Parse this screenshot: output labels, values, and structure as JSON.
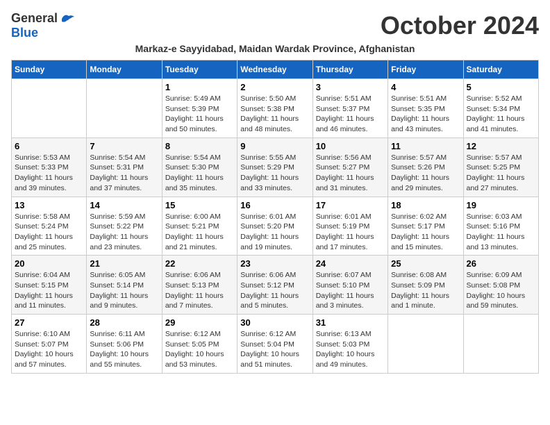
{
  "logo": {
    "general": "General",
    "blue": "Blue"
  },
  "title": "October 2024",
  "subtitle": "Markaz-e Sayyidabad, Maidan Wardak Province, Afghanistan",
  "weekdays": [
    "Sunday",
    "Monday",
    "Tuesday",
    "Wednesday",
    "Thursday",
    "Friday",
    "Saturday"
  ],
  "weeks": [
    [
      {
        "day": "",
        "sunrise": "",
        "sunset": "",
        "daylight": ""
      },
      {
        "day": "",
        "sunrise": "",
        "sunset": "",
        "daylight": ""
      },
      {
        "day": "1",
        "sunrise": "Sunrise: 5:49 AM",
        "sunset": "Sunset: 5:39 PM",
        "daylight": "Daylight: 11 hours and 50 minutes."
      },
      {
        "day": "2",
        "sunrise": "Sunrise: 5:50 AM",
        "sunset": "Sunset: 5:38 PM",
        "daylight": "Daylight: 11 hours and 48 minutes."
      },
      {
        "day": "3",
        "sunrise": "Sunrise: 5:51 AM",
        "sunset": "Sunset: 5:37 PM",
        "daylight": "Daylight: 11 hours and 46 minutes."
      },
      {
        "day": "4",
        "sunrise": "Sunrise: 5:51 AM",
        "sunset": "Sunset: 5:35 PM",
        "daylight": "Daylight: 11 hours and 43 minutes."
      },
      {
        "day": "5",
        "sunrise": "Sunrise: 5:52 AM",
        "sunset": "Sunset: 5:34 PM",
        "daylight": "Daylight: 11 hours and 41 minutes."
      }
    ],
    [
      {
        "day": "6",
        "sunrise": "Sunrise: 5:53 AM",
        "sunset": "Sunset: 5:33 PM",
        "daylight": "Daylight: 11 hours and 39 minutes."
      },
      {
        "day": "7",
        "sunrise": "Sunrise: 5:54 AM",
        "sunset": "Sunset: 5:31 PM",
        "daylight": "Daylight: 11 hours and 37 minutes."
      },
      {
        "day": "8",
        "sunrise": "Sunrise: 5:54 AM",
        "sunset": "Sunset: 5:30 PM",
        "daylight": "Daylight: 11 hours and 35 minutes."
      },
      {
        "day": "9",
        "sunrise": "Sunrise: 5:55 AM",
        "sunset": "Sunset: 5:29 PM",
        "daylight": "Daylight: 11 hours and 33 minutes."
      },
      {
        "day": "10",
        "sunrise": "Sunrise: 5:56 AM",
        "sunset": "Sunset: 5:27 PM",
        "daylight": "Daylight: 11 hours and 31 minutes."
      },
      {
        "day": "11",
        "sunrise": "Sunrise: 5:57 AM",
        "sunset": "Sunset: 5:26 PM",
        "daylight": "Daylight: 11 hours and 29 minutes."
      },
      {
        "day": "12",
        "sunrise": "Sunrise: 5:57 AM",
        "sunset": "Sunset: 5:25 PM",
        "daylight": "Daylight: 11 hours and 27 minutes."
      }
    ],
    [
      {
        "day": "13",
        "sunrise": "Sunrise: 5:58 AM",
        "sunset": "Sunset: 5:24 PM",
        "daylight": "Daylight: 11 hours and 25 minutes."
      },
      {
        "day": "14",
        "sunrise": "Sunrise: 5:59 AM",
        "sunset": "Sunset: 5:22 PM",
        "daylight": "Daylight: 11 hours and 23 minutes."
      },
      {
        "day": "15",
        "sunrise": "Sunrise: 6:00 AM",
        "sunset": "Sunset: 5:21 PM",
        "daylight": "Daylight: 11 hours and 21 minutes."
      },
      {
        "day": "16",
        "sunrise": "Sunrise: 6:01 AM",
        "sunset": "Sunset: 5:20 PM",
        "daylight": "Daylight: 11 hours and 19 minutes."
      },
      {
        "day": "17",
        "sunrise": "Sunrise: 6:01 AM",
        "sunset": "Sunset: 5:19 PM",
        "daylight": "Daylight: 11 hours and 17 minutes."
      },
      {
        "day": "18",
        "sunrise": "Sunrise: 6:02 AM",
        "sunset": "Sunset: 5:17 PM",
        "daylight": "Daylight: 11 hours and 15 minutes."
      },
      {
        "day": "19",
        "sunrise": "Sunrise: 6:03 AM",
        "sunset": "Sunset: 5:16 PM",
        "daylight": "Daylight: 11 hours and 13 minutes."
      }
    ],
    [
      {
        "day": "20",
        "sunrise": "Sunrise: 6:04 AM",
        "sunset": "Sunset: 5:15 PM",
        "daylight": "Daylight: 11 hours and 11 minutes."
      },
      {
        "day": "21",
        "sunrise": "Sunrise: 6:05 AM",
        "sunset": "Sunset: 5:14 PM",
        "daylight": "Daylight: 11 hours and 9 minutes."
      },
      {
        "day": "22",
        "sunrise": "Sunrise: 6:06 AM",
        "sunset": "Sunset: 5:13 PM",
        "daylight": "Daylight: 11 hours and 7 minutes."
      },
      {
        "day": "23",
        "sunrise": "Sunrise: 6:06 AM",
        "sunset": "Sunset: 5:12 PM",
        "daylight": "Daylight: 11 hours and 5 minutes."
      },
      {
        "day": "24",
        "sunrise": "Sunrise: 6:07 AM",
        "sunset": "Sunset: 5:10 PM",
        "daylight": "Daylight: 11 hours and 3 minutes."
      },
      {
        "day": "25",
        "sunrise": "Sunrise: 6:08 AM",
        "sunset": "Sunset: 5:09 PM",
        "daylight": "Daylight: 11 hours and 1 minute."
      },
      {
        "day": "26",
        "sunrise": "Sunrise: 6:09 AM",
        "sunset": "Sunset: 5:08 PM",
        "daylight": "Daylight: 10 hours and 59 minutes."
      }
    ],
    [
      {
        "day": "27",
        "sunrise": "Sunrise: 6:10 AM",
        "sunset": "Sunset: 5:07 PM",
        "daylight": "Daylight: 10 hours and 57 minutes."
      },
      {
        "day": "28",
        "sunrise": "Sunrise: 6:11 AM",
        "sunset": "Sunset: 5:06 PM",
        "daylight": "Daylight: 10 hours and 55 minutes."
      },
      {
        "day": "29",
        "sunrise": "Sunrise: 6:12 AM",
        "sunset": "Sunset: 5:05 PM",
        "daylight": "Daylight: 10 hours and 53 minutes."
      },
      {
        "day": "30",
        "sunrise": "Sunrise: 6:12 AM",
        "sunset": "Sunset: 5:04 PM",
        "daylight": "Daylight: 10 hours and 51 minutes."
      },
      {
        "day": "31",
        "sunrise": "Sunrise: 6:13 AM",
        "sunset": "Sunset: 5:03 PM",
        "daylight": "Daylight: 10 hours and 49 minutes."
      },
      {
        "day": "",
        "sunrise": "",
        "sunset": "",
        "daylight": ""
      },
      {
        "day": "",
        "sunrise": "",
        "sunset": "",
        "daylight": ""
      }
    ]
  ]
}
